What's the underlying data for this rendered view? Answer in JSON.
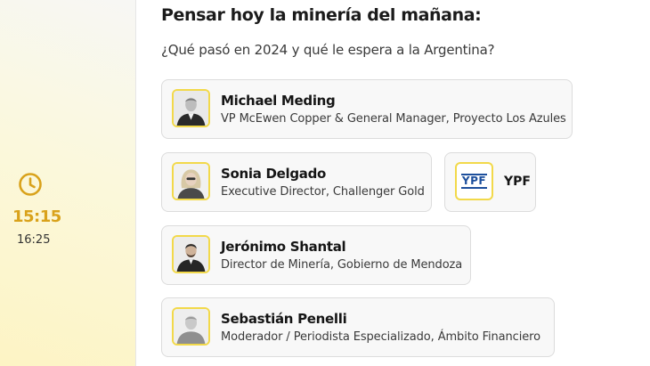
{
  "session": {
    "title": "Pensar hoy la minería del mañana:",
    "subtitle": "¿Qué pasó en 2024 y qué le espera a la Argentina?",
    "time_start": "15:15",
    "time_end": "16:25"
  },
  "speakers": [
    {
      "name": "Michael Meding",
      "role": "VP McEwen Copper & General Manager, Proyecto Los Azules"
    },
    {
      "name": "Sonia Delgado",
      "role": "Executive Director, Challenger Gold"
    },
    {
      "name": "Jerónimo Shantal",
      "role": "Director de Minería, Gobierno de Mendoza"
    },
    {
      "name": "Sebastián Penelli",
      "role": "Moderador / Periodista Especializado, Ámbito Financiero"
    }
  ],
  "company": {
    "name": "YPF",
    "logo_text": "YPF"
  },
  "colors": {
    "accent": "#d9a21b",
    "avatar_border": "#f2d94a",
    "logo_blue": "#1d4f9c"
  },
  "icons": {
    "time": "clock-icon"
  }
}
